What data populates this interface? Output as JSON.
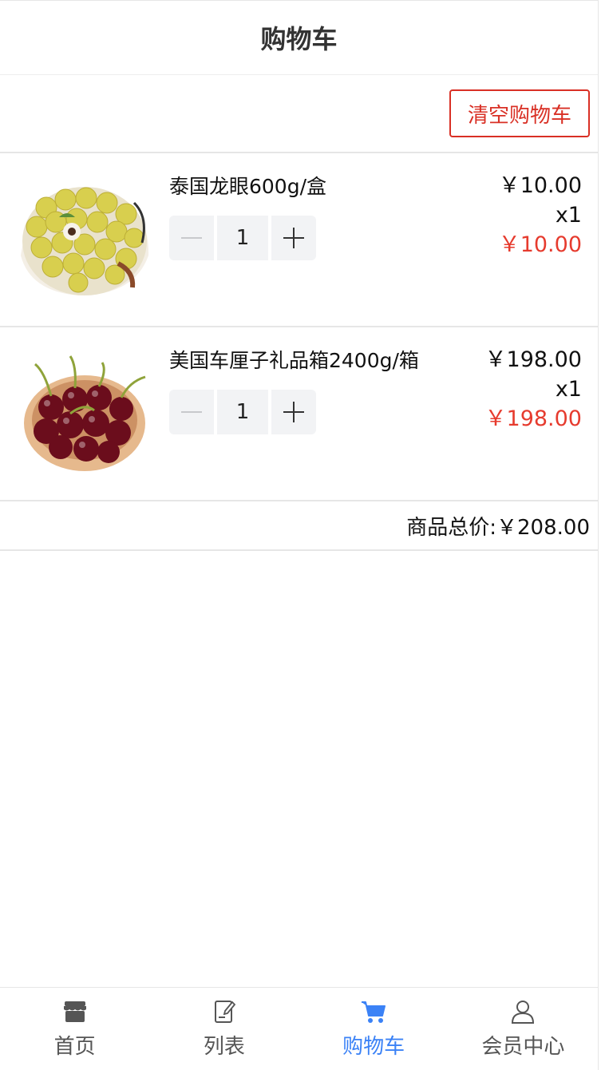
{
  "navbar": {
    "title": "购物车"
  },
  "actions": {
    "clear_label": "清空购物车"
  },
  "cart": {
    "items": [
      {
        "name": "泰国龙眼600g/盒",
        "unit_price": "￥10.00",
        "count": "x1",
        "subtotal": "￥10.00",
        "qty": "1",
        "image": "longan-box-image"
      },
      {
        "name": "美国车厘子礼品箱2400g/箱",
        "unit_price": "￥198.00",
        "count": "x1",
        "subtotal": "￥198.00",
        "qty": "1",
        "image": "cherries-bowl-image"
      }
    ],
    "total_label": "商品总价:",
    "total_value": "￥208.00"
  },
  "colors": {
    "accent": "#3b82f6",
    "danger": "#d93025",
    "price_red": "#e63b2e"
  },
  "tabbar": {
    "tabs": [
      {
        "label": "首页",
        "icon": "store-icon"
      },
      {
        "label": "列表",
        "icon": "document-icon"
      },
      {
        "label": "购物车",
        "icon": "cart-icon",
        "active": true
      },
      {
        "label": "会员中心",
        "icon": "user-icon"
      }
    ]
  }
}
